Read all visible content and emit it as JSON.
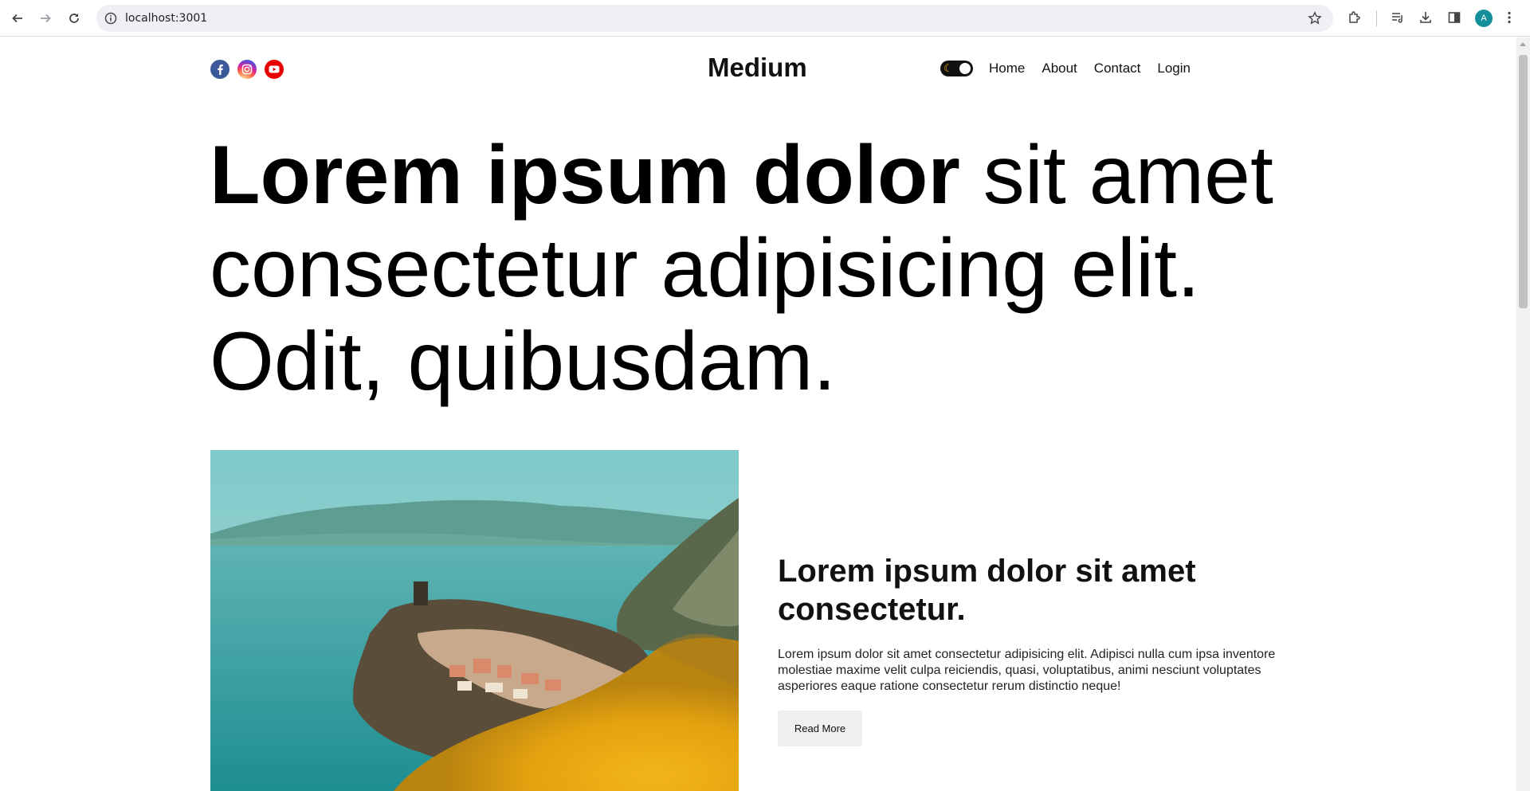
{
  "browser": {
    "url": "localhost:3001",
    "avatar_letter": "A"
  },
  "header": {
    "socials": [
      "facebook-icon",
      "instagram-icon",
      "youtube-icon"
    ],
    "logo": "Medium",
    "nav": {
      "home": "Home",
      "about": "About",
      "contact": "Contact",
      "login": "Login"
    }
  },
  "hero": {
    "bold_text": "Lorem ipsum dolor",
    "light_text": "sit amet consectetur adipisicing elit. Odit, quibusdam."
  },
  "featured": {
    "title": "Lorem ipsum dolor sit amet consectetur.",
    "description": "Lorem ipsum dolor sit amet consectetur adipisicing elit. Adipisci nulla cum ipsa inventore molestiae maxime velit culpa reiciendis, quasi, voluptatibus, animi nesciunt voluptates asperiores eaque ratione consectetur rerum distinctio neque!",
    "button": "Read More"
  },
  "colors": {
    "facebook": "#3b5998",
    "youtube": "#e80000",
    "avatar": "#15909a",
    "toggle_bg": "#111111",
    "moon": "#f6b400"
  }
}
